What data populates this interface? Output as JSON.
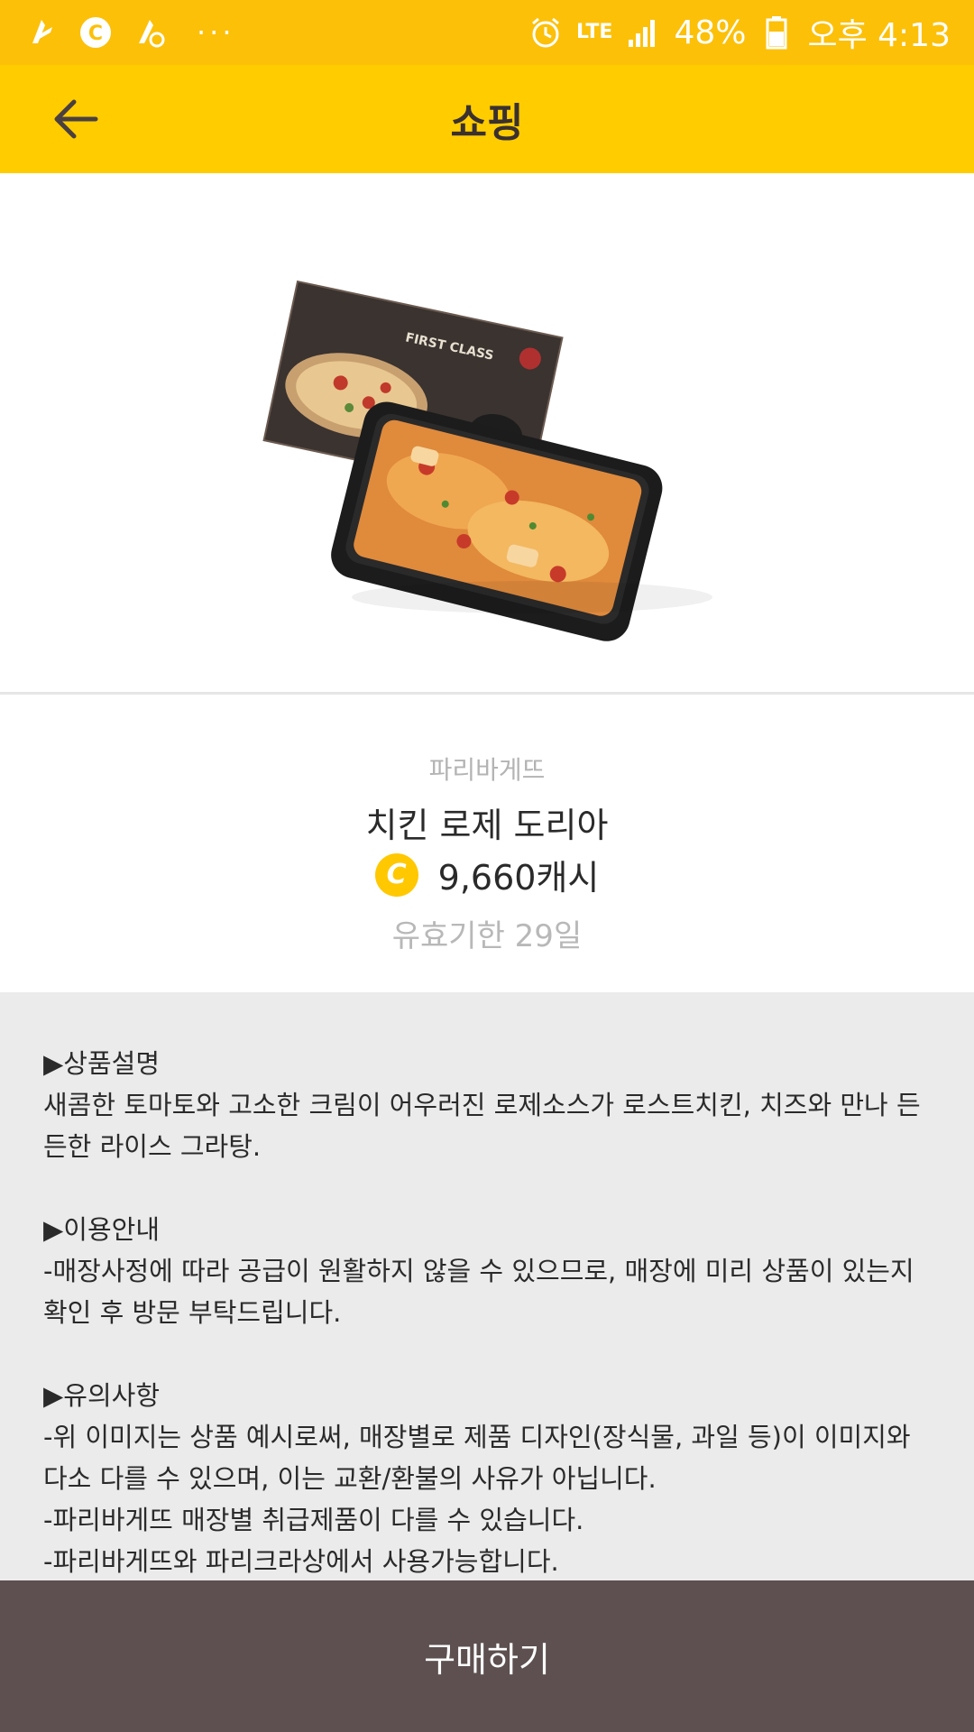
{
  "status_bar": {
    "battery_percent": "48%",
    "network": "LTE",
    "time": "오후 4:13",
    "more_dots": "···"
  },
  "app_bar": {
    "title": "쇼핑"
  },
  "product": {
    "brand": "파리바게뜨",
    "name": "치킨 로제 도리아",
    "coin_symbol": "C",
    "price": "9,660캐시",
    "validity": "유효기한 29일"
  },
  "description": {
    "section1_title": "▶상품설명",
    "section1_body": "새콤한 토마토와 고소한 크림이 어우러진 로제소스가 로스트치킨, 치즈와 만나 든든한 라이스 그라탕.",
    "section2_title": "▶이용안내",
    "section2_body": "-매장사정에 따라 공급이 원활하지 않을 수 있으므로, 매장에 미리 상품이 있는지 확인 후 방문 부탁드립니다.",
    "section3_title": "▶유의사항",
    "section3_lines": [
      "-위 이미지는 상품 예시로써, 매장별로 제품 디자인(장식물, 과일 등)이 이미지와 다소 다를 수 있으며, 이는 교환/환불의 사유가 아닙니다.",
      "-파리바게뜨 매장별 취급제품이 다를 수 있습니다.",
      "-파리바게뜨와 파리크라상에서 사용가능합니다."
    ]
  },
  "box_label": "FIRST CLASS",
  "buy_button": {
    "label": "구매하기"
  },
  "colors": {
    "status_bar": "#FCC009",
    "app_bar": "#FFCC00",
    "buy_button": "#5E5050",
    "description_bg": "#EBEBEB"
  }
}
